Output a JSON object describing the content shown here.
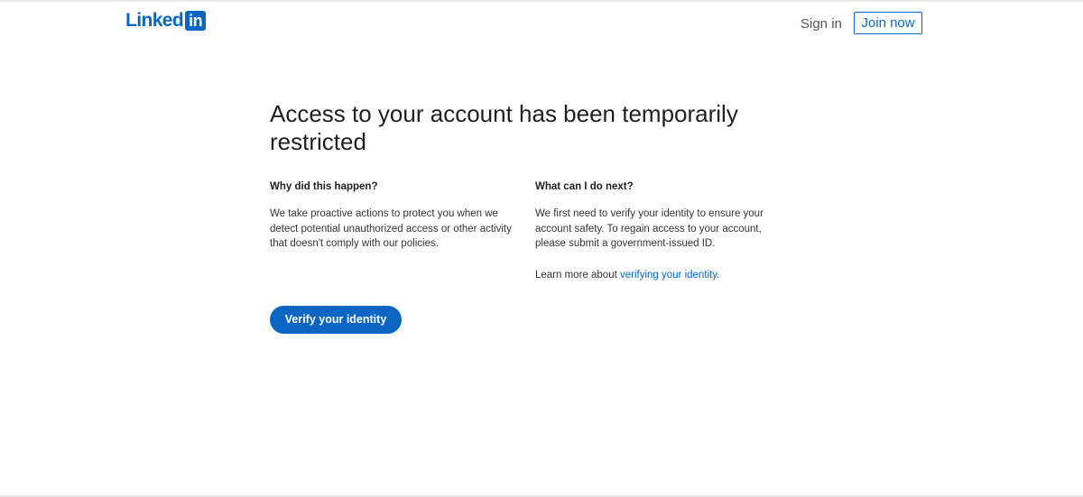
{
  "header": {
    "logo": {
      "word": "Linked",
      "box": "in"
    },
    "sign_in": "Sign in",
    "join_now": "Join now"
  },
  "main": {
    "title": "Access to your account has been temporarily restricted",
    "left": {
      "heading": "Why did this happen?",
      "body": "We take proactive actions to protect you when we detect potential unauthorized access or other activity that doesn't comply with our policies."
    },
    "right": {
      "heading": "What can I do next?",
      "body": "We first need to verify your identity to ensure your account safety. To regain access to your account, please submit a government-issued ID.",
      "learn_prefix": "Learn more about ",
      "learn_link": "verifying your identity",
      "learn_suffix": "."
    },
    "verify_button": "Verify your identity"
  },
  "colors": {
    "brand": "#0a66c2",
    "text": "#1f1f1f"
  }
}
